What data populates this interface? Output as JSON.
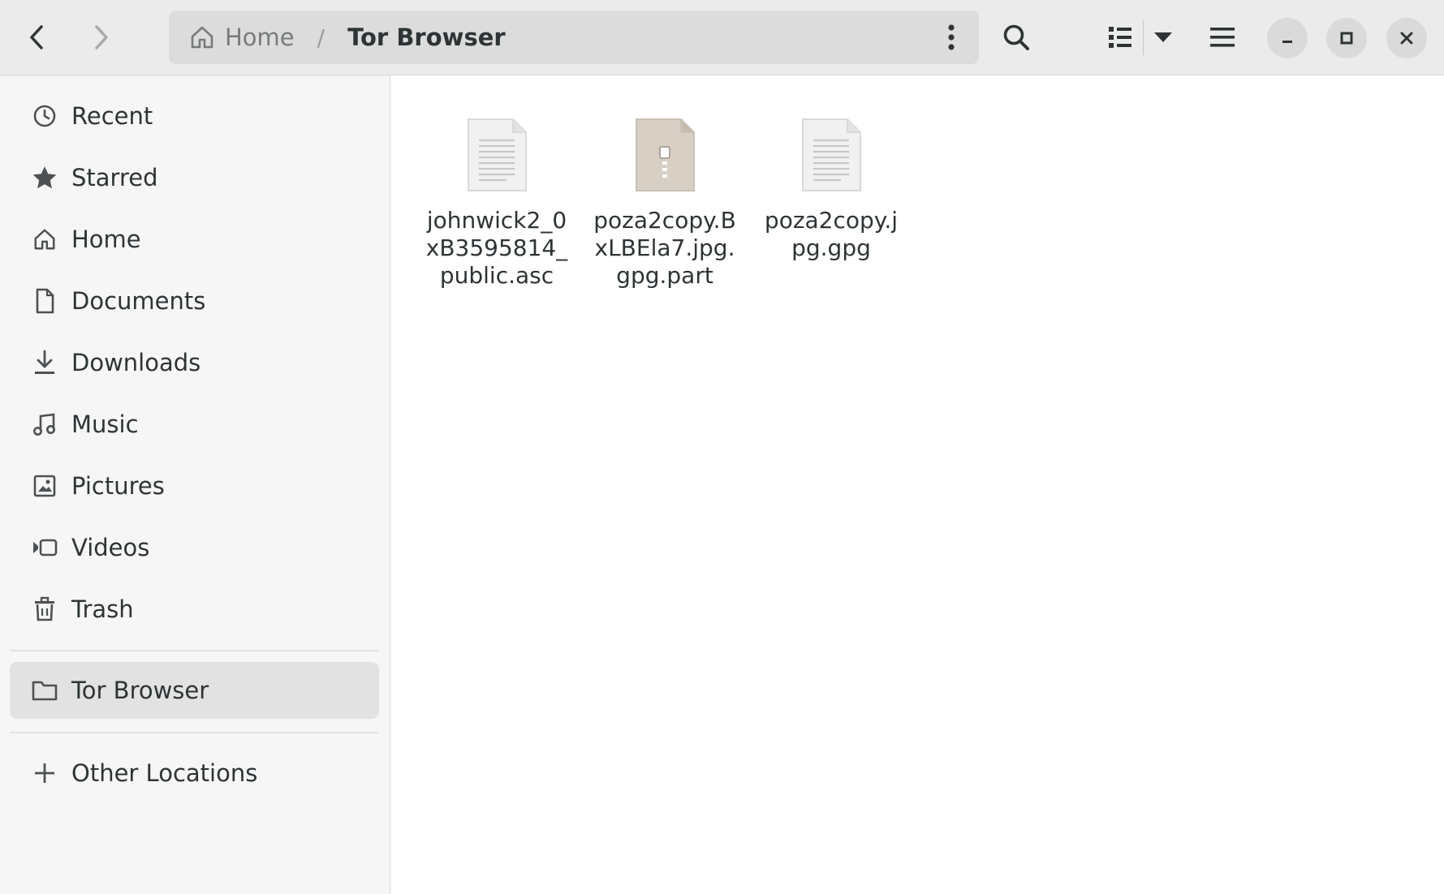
{
  "window": {
    "app": "Files"
  },
  "header": {
    "back_icon": "go-previous-icon",
    "forward_icon": "go-next-icon",
    "path": [
      {
        "label": "Home",
        "icon": "home-icon"
      },
      {
        "label": "Tor Browser"
      }
    ],
    "path_separator": "/",
    "path_menu_icon": "view-more-vertical-icon",
    "search_icon": "search-icon",
    "view_icon": "view-list-icon",
    "view_dropdown_icon": "pan-down-icon",
    "menu_icon": "open-menu-icon",
    "window_controls": [
      "minimize-icon",
      "maximize-icon",
      "close-icon"
    ]
  },
  "sidebar": {
    "items": [
      {
        "label": "Recent",
        "icon": "clock-icon"
      },
      {
        "label": "Starred",
        "icon": "star-icon"
      },
      {
        "label": "Home",
        "icon": "home-icon"
      },
      {
        "label": "Documents",
        "icon": "document-icon"
      },
      {
        "label": "Downloads",
        "icon": "download-icon"
      },
      {
        "label": "Music",
        "icon": "music-icon"
      },
      {
        "label": "Pictures",
        "icon": "picture-icon"
      },
      {
        "label": "Videos",
        "icon": "video-icon"
      },
      {
        "label": "Trash",
        "icon": "trash-icon"
      }
    ],
    "bookmarks": [
      {
        "label": "Tor Browser",
        "icon": "folder-icon",
        "active": true
      }
    ],
    "other": {
      "label": "Other Locations",
      "icon": "plus-icon"
    }
  },
  "files": [
    {
      "name": "johnwick2_0\nxB3595814_\npublic.asc",
      "icon": "text-file-icon"
    },
    {
      "name": "poza2copy.B\nxLBEla7.jpg.\ngpg.part",
      "icon": "archive-file-icon"
    },
    {
      "name": "poza2copy.j\npg.gpg",
      "icon": "text-file-icon"
    }
  ],
  "colors": {
    "header_bg": "#ebebeb",
    "sidebar_bg": "#f6f6f6",
    "active_row": "#e2e2e2",
    "archive_icon": "#d8cfc5"
  }
}
